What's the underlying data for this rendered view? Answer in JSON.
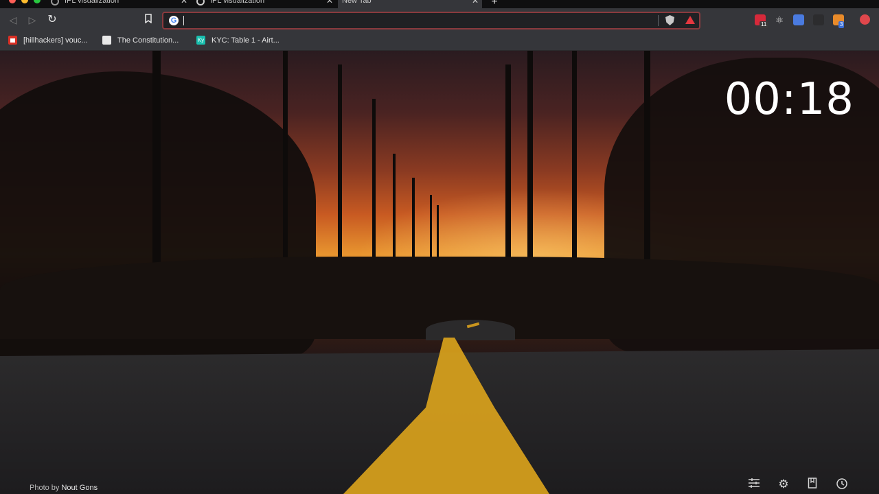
{
  "tabs": [
    {
      "label": "IPL visualization",
      "active": false
    },
    {
      "label": "IPL visualization",
      "active": false
    },
    {
      "label": "New Tab",
      "active": true
    }
  ],
  "toolbar": {
    "back_icon": "back-arrow-icon",
    "forward_icon": "forward-arrow-icon",
    "reload_icon": "reload-icon",
    "bookmark_icon": "bookmark-icon",
    "omnibox": {
      "value": "",
      "placeholder": ""
    },
    "extensions": [
      {
        "name": "red-extension-icon",
        "badge": "11",
        "color": "#d6293a"
      },
      {
        "name": "react-devtools-icon",
        "badge": "",
        "color": "#d6d6d6"
      },
      {
        "name": "google-translate-icon",
        "badge": "",
        "color": "#4a7be0"
      },
      {
        "name": "dark-extension-icon",
        "badge": "",
        "color": "#2c2c2e"
      },
      {
        "name": "orange-extension-icon",
        "badge": "3",
        "color": "#e98b2a"
      },
      {
        "name": "profile-icon",
        "badge": "",
        "color": "#e0474c"
      }
    ]
  },
  "bookmarks": [
    {
      "label": "[hillhackers] vouc...",
      "icon": "gmail-icon",
      "color": "#d93025"
    },
    {
      "label": "The Constitution...",
      "icon": "constitution-icon",
      "color": "#e8e8e8"
    },
    {
      "label": "KYC: Table 1 - Airt...",
      "icon": "airtable-icon",
      "color": "#18bfae"
    }
  ],
  "wallpaper": {
    "clock": "00:18",
    "credit_prefix": "Photo by",
    "credit_author": "Nout Gons"
  },
  "bottom_icons": [
    "sliders-icon",
    "gear-icon",
    "bookmark-icon",
    "history-icon"
  ]
}
